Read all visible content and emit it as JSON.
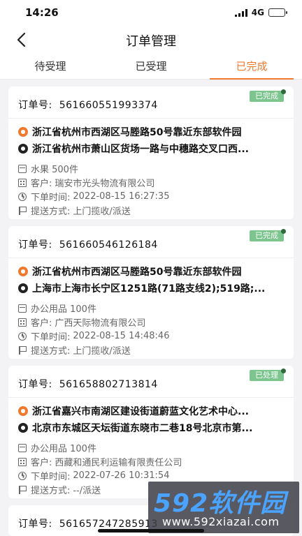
{
  "status_bar": {
    "time": "14:26",
    "network": "4G"
  },
  "header": {
    "title": "订单管理"
  },
  "tabs": [
    {
      "label": "待受理",
      "active": false
    },
    {
      "label": "已受理",
      "active": false
    },
    {
      "label": "已完成",
      "active": true
    }
  ],
  "colors": {
    "accent": "#ef7a2e",
    "badge": "#7cc58e"
  },
  "orders": [
    {
      "order_label": "订单号:",
      "order_no": "561660551993374",
      "status": "已完成",
      "from": "浙江省杭州市西湖区马塍路50号靠近东部软件园",
      "to": "浙江省杭州市萧山区货场一路与中穗路交叉口西...",
      "goods": "水果  500件",
      "customer_label": "客户:",
      "customer": "瑞安市光头物流有限公司",
      "time_label": "下单时间:",
      "time": "2022-08-15 16:27:35",
      "method_label": "提送方式:",
      "method": "上门揽收/派送"
    },
    {
      "order_label": "订单号:",
      "order_no": "561660546126184",
      "status": "已完成",
      "from": "浙江省杭州市西湖区马塍路50号靠近东部软件园",
      "to": "上海市上海市长宁区1251路(71路支线2);519路;...",
      "goods": "办公用品  100件",
      "customer_label": "客户:",
      "customer": "广西天际物流有限公司",
      "time_label": "下单时间:",
      "time": "2022-08-15 14:48:46",
      "method_label": "提送方式:",
      "method": "上门揽收/派送"
    },
    {
      "order_label": "订单号:",
      "order_no": "561658802713814",
      "status": "已处理",
      "from": "浙江省嘉兴市南湖区建设街道蔚蓝文化艺术中心...",
      "to": "北京市东城区天坛街道东晓市二巷18号北京市第...",
      "goods": "办公用品  100件",
      "customer_label": "客户:",
      "customer": "西藏和通民利运输有限责任公司",
      "time_label": "下单时间:",
      "time": "2022-07-26 10:31:54",
      "method_label": "提送方式:",
      "method": "--/派送"
    },
    {
      "order_label": "订单号:",
      "order_no": "561657247285913"
    }
  ],
  "watermark": {
    "main": "592软件园",
    "sub": "www.592xiazai.com"
  }
}
